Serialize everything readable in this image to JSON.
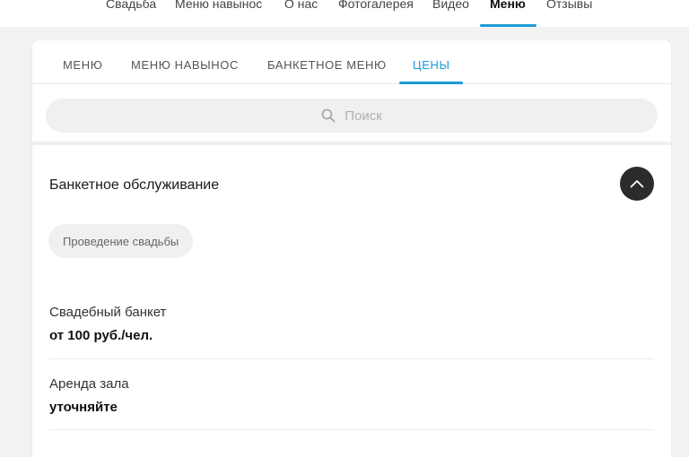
{
  "topnav": {
    "items": [
      {
        "label": "Свадьба"
      },
      {
        "label": "Меню навынос"
      },
      {
        "label": "О нас"
      },
      {
        "label": "Фотогалерея"
      },
      {
        "label": "Видео"
      },
      {
        "label": "Меню",
        "active": true
      },
      {
        "label": "Отзывы"
      }
    ]
  },
  "tabs": [
    {
      "label": "МЕНЮ"
    },
    {
      "label": "МЕНЮ НАВЫНОС"
    },
    {
      "label": "БАНКЕТНОЕ МЕНЮ"
    },
    {
      "label": "ЦЕНЫ",
      "active": true
    }
  ],
  "search": {
    "placeholder": "Поиск",
    "icon": "search-icon"
  },
  "section": {
    "title": "Банкетное обслуживание",
    "collapse_icon": "chevron-up-icon",
    "chip": "Проведение свадьбы"
  },
  "prices": [
    {
      "name": "Свадебный банкет",
      "value": "от 100 руб./чел."
    },
    {
      "name": "Аренда зала",
      "value": "уточняйте"
    }
  ],
  "colors": {
    "accent": "#1a9bd7",
    "dark_button": "#2b2b2b",
    "background": "#f2f2f2"
  }
}
